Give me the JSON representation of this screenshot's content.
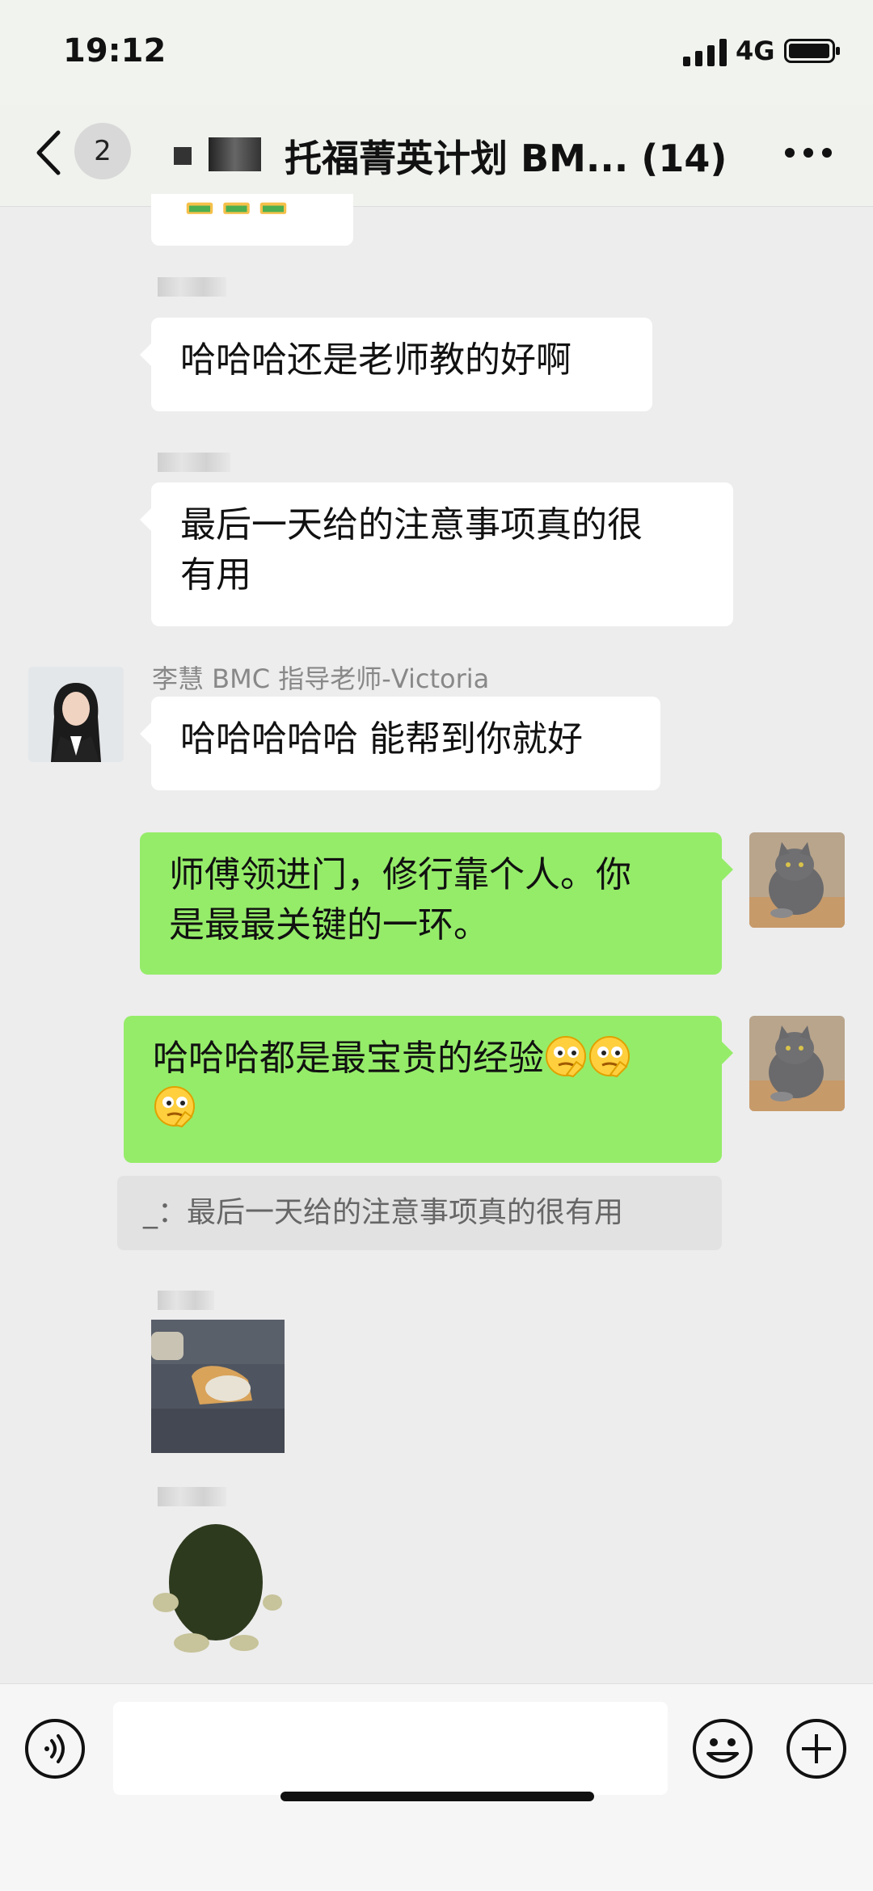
{
  "status_bar": {
    "time": "19:12",
    "network": "4G"
  },
  "header": {
    "back_badge": "2",
    "title": "托福菁英计划 BM...  (14)"
  },
  "messages": {
    "m1_text": "哈哈哈还是老师教的好啊",
    "m2_line1": "最后一天给的注意事项真的很",
    "m2_line2": "有用",
    "teacher_name": "李慧 BMC 指导老师-Victoria",
    "m3_text": "哈哈哈哈哈 能帮到你就好",
    "m4_line1": "师傅领进门，修行靠个人。你",
    "m4_line2": "是最最关键的一环。",
    "m5_text": "哈哈哈都是最宝贵的经验",
    "m5_emoji_count": 3,
    "quote_text": "_：最后一天给的注意事项真的很有用"
  },
  "icons": {
    "back": "chevron-left-icon",
    "more": "more-dots-icon",
    "voice": "voice-icon",
    "emoji": "emoji-icon",
    "plus": "plus-icon"
  },
  "colors": {
    "outgoing_bubble": "#95ec69",
    "incoming_bubble": "#ffffff",
    "background": "#ededed"
  }
}
